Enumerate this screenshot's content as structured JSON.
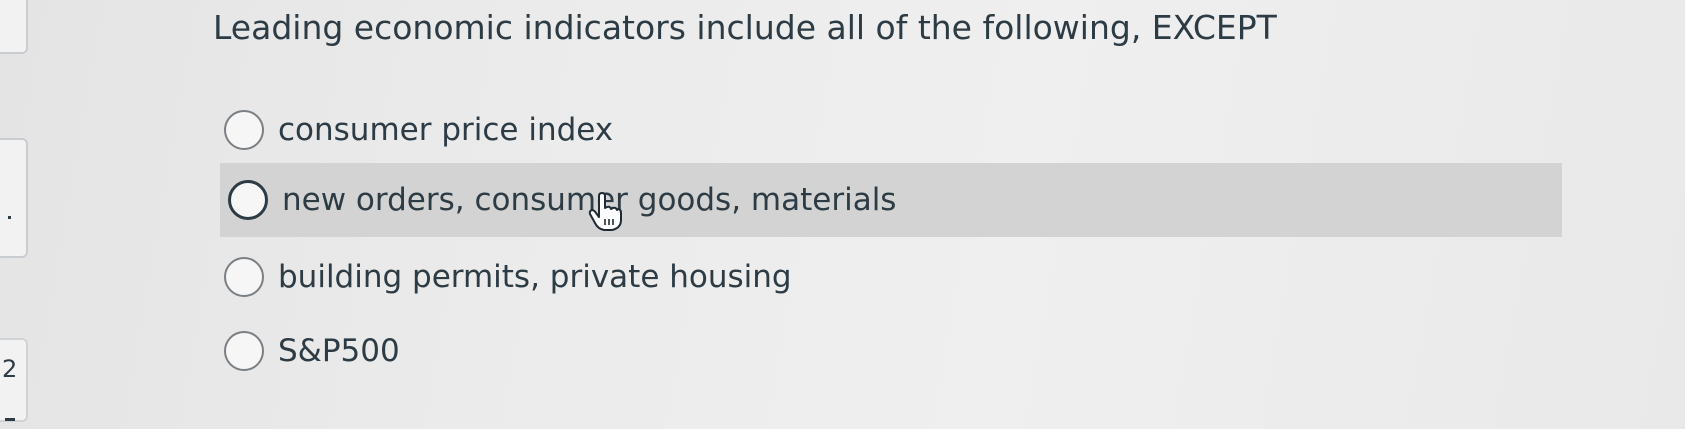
{
  "sidebar": {
    "question_number": "2"
  },
  "question": {
    "text": "Leading economic indicators include all of the following, EXCEPT"
  },
  "answers": [
    {
      "label": "consumer price index"
    },
    {
      "label": "new orders, consumer goods, materials"
    },
    {
      "label": "building permits, private housing"
    },
    {
      "label": "S&P500"
    }
  ],
  "cursor": {
    "icon": "hand-pointer-icon"
  },
  "colors": {
    "text": "#2d3b45",
    "hover_row": "#d3d3d3",
    "background": "#ebebeb"
  }
}
